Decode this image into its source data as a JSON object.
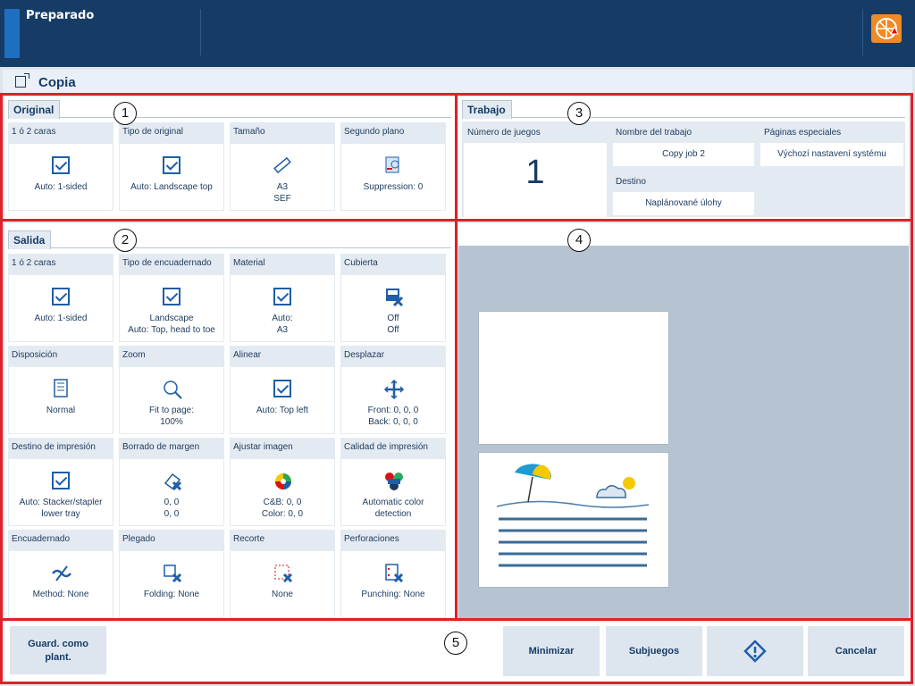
{
  "topbar": {
    "status": "Preparado"
  },
  "title": "Copia",
  "callouts": [
    "1",
    "2",
    "3",
    "4",
    "5"
  ],
  "original": {
    "header": "Original",
    "tiles": [
      {
        "label": "1 ó 2 caras",
        "icon": "checkbox",
        "value": "Auto: 1-sided"
      },
      {
        "label": "Tipo de original",
        "icon": "checkbox",
        "value": "Auto: Landscape top"
      },
      {
        "label": "Tamaño",
        "icon": "ruler-icon",
        "value": "A3\nSEF"
      },
      {
        "label": "Segundo plano",
        "icon": "background-suppression-icon",
        "value": "Suppression: 0"
      }
    ]
  },
  "trabajo": {
    "header": "Trabajo",
    "copies_label": "Número de juegos",
    "copies_value": "1",
    "job_name_label": "Nombre del trabajo",
    "job_name_value": "Copy job 2",
    "special_pages_label": "Páginas especiales",
    "special_pages_value": "Výchozí nastavení systému",
    "destination_label": "Destino",
    "destination_value": "Naplánované úlohy"
  },
  "salida": {
    "header": "Salida",
    "tiles": [
      {
        "label": "1 ó 2 caras",
        "icon": "checkbox",
        "value": "Auto: 1-sided"
      },
      {
        "label": "Tipo de encuadernado",
        "icon": "checkbox",
        "value": "Landscape\nAuto: Top, head to toe"
      },
      {
        "label": "Material",
        "icon": "checkbox",
        "value": "Auto:\nA3"
      },
      {
        "label": "Cubierta",
        "icon": "cover-off-icon",
        "value": "Off\nOff"
      },
      {
        "label": "Disposición",
        "icon": "layout-icon",
        "value": "Normal"
      },
      {
        "label": "Zoom",
        "icon": "magnifier-icon",
        "value": "Fit to page:\n100%"
      },
      {
        "label": "Alinear",
        "icon": "checkbox",
        "value": "Auto: Top left"
      },
      {
        "label": "Desplazar",
        "icon": "shift-icon",
        "value": "Front: 0, 0, 0\nBack: 0, 0, 0"
      },
      {
        "label": "Destino de impresión",
        "icon": "checkbox",
        "value": "Auto: Stacker/stapler\nlower tray"
      },
      {
        "label": "Borrado de margen",
        "icon": "edge-erase-icon",
        "value": "0, 0\n0, 0"
      },
      {
        "label": "Ajustar imagen",
        "icon": "color-wheel-icon",
        "value": "C&B: 0, 0\nColor: 0, 0"
      },
      {
        "label": "Calidad de impresión",
        "icon": "auto-color-icon",
        "value": "Automatic color\ndetection"
      },
      {
        "label": "Encuadernado",
        "icon": "binding-off-icon",
        "value": "Method: None"
      },
      {
        "label": "Plegado",
        "icon": "folding-off-icon",
        "value": "Folding: None"
      },
      {
        "label": "Recorte",
        "icon": "trimming-off-icon",
        "value": "None"
      },
      {
        "label": "Perforaciones",
        "icon": "punching-off-icon",
        "value": "Punching: None"
      }
    ]
  },
  "footer": {
    "save_template": "Guard. como\nplant.",
    "minimize": "Minimizar",
    "subsets": "Subjuegos",
    "start_icon": "start-diamond-icon",
    "cancel": "Cancelar"
  },
  "colors": {
    "topbar": "#163c66",
    "accent": "#1f6fc1",
    "callout_frame": "#e0202a",
    "preview_bg": "#b6c3d1"
  }
}
